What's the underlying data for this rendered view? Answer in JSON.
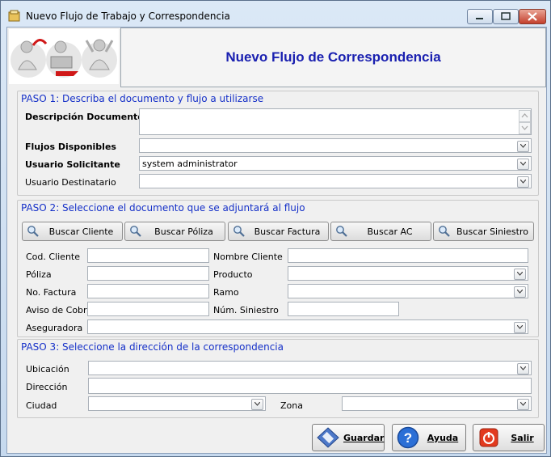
{
  "window": {
    "title": "Nuevo Flujo de Trabajo y Correspondencia"
  },
  "banner": {
    "title": "Nuevo Flujo de Correspondencia"
  },
  "paso1": {
    "title": "PASO 1: Describa el documento y flujo a utilizarse",
    "descripcion_label": "Descripción Documento",
    "descripcion_value": "",
    "flujos_label": "Flujos Disponibles",
    "flujos_value": "",
    "solicitante_label": "Usuario Solicitante",
    "solicitante_value": "system administrator",
    "destinatario_label": "Usuario Destinatario",
    "destinatario_value": ""
  },
  "paso2": {
    "title": "PASO 2: Seleccione el documento que se adjuntará al flujo",
    "buttons": {
      "cliente": "Buscar Cliente",
      "poliza": "Buscar Póliza",
      "factura": "Buscar Factura",
      "ac": "Buscar AC",
      "siniestro": "Buscar Siniestro"
    },
    "cod_cliente_label": "Cod. Cliente",
    "nombre_cliente_label": "Nombre Cliente",
    "poliza_label": "Póliza",
    "producto_label": "Producto",
    "no_factura_label": "No. Factura",
    "ramo_label": "Ramo",
    "aviso_cobro_label": "Aviso de Cobro",
    "num_siniestro_label": "Núm. Siniestro",
    "aseguradora_label": "Aseguradora"
  },
  "paso3": {
    "title": "PASO 3: Seleccione la dirección de la correspondencia",
    "ubicacion_label": "Ubicación",
    "direccion_label": "Dirección",
    "ciudad_label": "Ciudad",
    "zona_label": "Zona"
  },
  "actions": {
    "guardar": "Guardar",
    "ayuda": "Ayuda",
    "salir": "Salir"
  },
  "colors": {
    "accent": "#1530c8",
    "banner_title": "#1a20b0"
  }
}
